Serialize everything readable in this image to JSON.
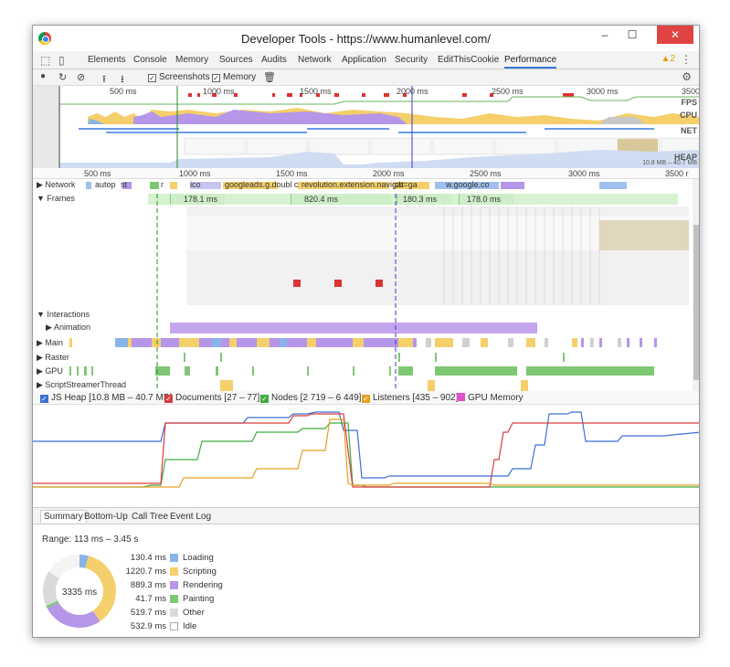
{
  "window": {
    "title": "Developer Tools - https://www.humanlevel.com/",
    "controls": {
      "minimize": "–",
      "maximize": "☐",
      "close": "✕"
    }
  },
  "tabs": [
    {
      "label": "Elements"
    },
    {
      "label": "Console"
    },
    {
      "label": "Memory"
    },
    {
      "label": "Sources"
    },
    {
      "label": "Audits"
    },
    {
      "label": "Network"
    },
    {
      "label": "Application"
    },
    {
      "label": "Security"
    },
    {
      "label": "EditThisCookie"
    },
    {
      "label": "Performance"
    }
  ],
  "warnings": {
    "count": "2",
    "icon": "warning-icon"
  },
  "toolbar": {
    "screenshots_label": "Screenshots",
    "memory_label": "Memory"
  },
  "overview": {
    "ticks": [
      "500 ms",
      "1000 ms",
      "1500 ms",
      "2000 ms",
      "2500 ms",
      "3000 ms",
      "3500"
    ],
    "lanes": [
      "FPS",
      "CPU",
      "NET",
      "HEAP"
    ],
    "heap_range": "10.8 MB – 40.7 MB"
  },
  "timeline": {
    "ticks": [
      "500 ms",
      "1000 ms",
      "1500 ms",
      "2000 ms",
      "2500 ms",
      "3000 ms",
      "3500 r"
    ],
    "network_label": "Network",
    "network_items": [
      "autop",
      "st",
      "r",
      "ico",
      "googleads.g.doubl",
      "c",
      "revolution.extension.navigat",
      "cb=ga",
      "w.google.co"
    ],
    "frames_label": "Frames",
    "frames": [
      {
        "label": "178.1 ms"
      },
      {
        "label": "820.4 ms"
      },
      {
        "label": "180.3 ms"
      },
      {
        "label": "178.0 ms"
      }
    ],
    "interactions_label": "Interactions",
    "animation_label": "Animation",
    "main_label": "Main",
    "raster_label": "Raster",
    "gpu_label": "GPU",
    "script_label": "ScriptStreamerThread"
  },
  "memory_legend": [
    {
      "label": "JS Heap [10.8 MB – 40.7 MB]",
      "color": "#3b6fd6"
    },
    {
      "label": "Documents [27 – 77]",
      "color": "#d93c3c"
    },
    {
      "label": "Nodes [2 719 – 6 449]",
      "color": "#3faa3f"
    },
    {
      "label": "Listeners [435 – 902]",
      "color": "#e6a023"
    },
    {
      "label": "GPU Memory",
      "color": "#e052c9"
    }
  ],
  "bottom_tabs": [
    {
      "label": "Summary"
    },
    {
      "label": "Bottom-Up"
    },
    {
      "label": "Call Tree"
    },
    {
      "label": "Event Log"
    }
  ],
  "summary": {
    "range": "Range: 113 ms – 3.45 s",
    "total": "3335 ms",
    "rows": [
      {
        "value": "130.4 ms",
        "name": "Loading",
        "color": "#8ab4e8",
        "ms": 130.4
      },
      {
        "value": "1220.7 ms",
        "name": "Scripting",
        "color": "#f5cf6b",
        "ms": 1220.7
      },
      {
        "value": "889.3 ms",
        "name": "Rendering",
        "color": "#b596e8",
        "ms": 889.3
      },
      {
        "value": "41.7 ms",
        "name": "Painting",
        "color": "#7fc774",
        "ms": 41.7
      },
      {
        "value": "519.7 ms",
        "name": "Other",
        "color": "#dadada",
        "ms": 519.7
      },
      {
        "value": "532.9 ms",
        "name": "Idle",
        "color": "#ffffff",
        "ms": 532.9
      }
    ]
  }
}
